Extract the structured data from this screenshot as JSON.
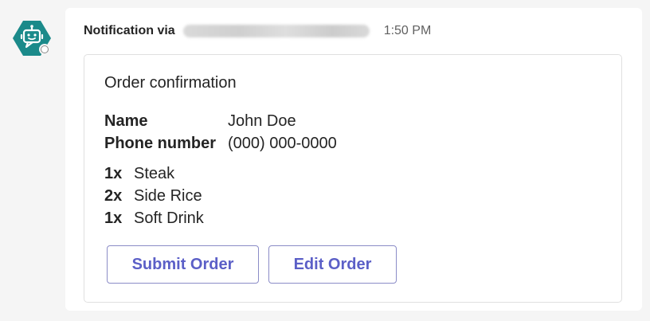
{
  "bot": {
    "avatar_icon": "bot-icon",
    "avatar_color": "#1b8a8a",
    "presence": "offline"
  },
  "message": {
    "sender_prefix": "Notification via",
    "timestamp": "1:50 PM"
  },
  "card": {
    "title": "Order confirmation",
    "facts": [
      {
        "key": "Name",
        "value": "John Doe"
      },
      {
        "key": "Phone number",
        "value": "(000) 000-0000"
      }
    ],
    "items": [
      {
        "qty": "1x",
        "name": "Steak"
      },
      {
        "qty": "2x",
        "name": "Side Rice"
      },
      {
        "qty": "1x",
        "name": "Soft Drink"
      }
    ],
    "actions": {
      "submit_label": "Submit Order",
      "edit_label": "Edit Order"
    },
    "accent_color": "#5b5fc7"
  }
}
